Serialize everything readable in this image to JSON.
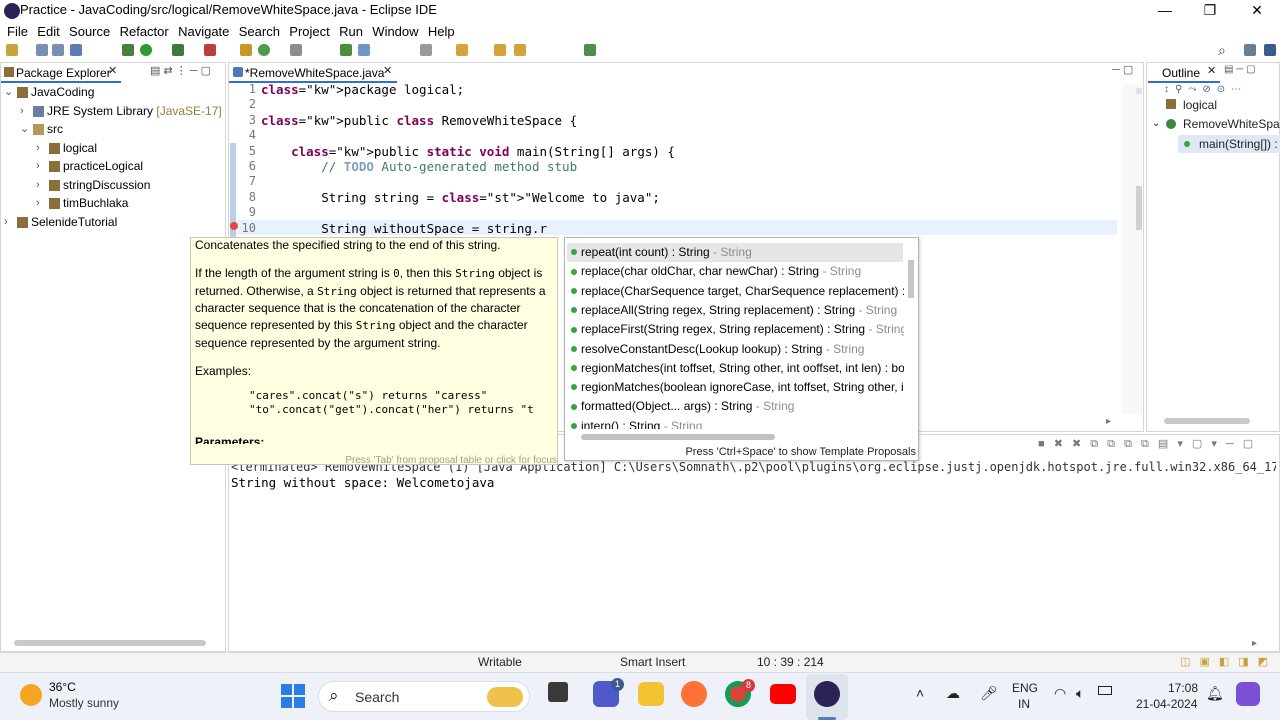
{
  "window": {
    "title": "Practice - JavaCoding/src/logical/RemoveWhiteSpace.java - Eclipse IDE",
    "minimize": "—",
    "maximize": "❐",
    "close": "✕"
  },
  "menu": [
    "File",
    "Edit",
    "Source",
    "Refactor",
    "Navigate",
    "Search",
    "Project",
    "Run",
    "Window",
    "Help"
  ],
  "package_explorer": {
    "title": "Package Explorer",
    "tree": [
      {
        "label": "JavaCoding",
        "twisty": "⌄",
        "depth": 0
      },
      {
        "label": "JRE System Library",
        "suffix": "[JavaSE-17]",
        "twisty": "›",
        "depth": 1
      },
      {
        "label": "src",
        "twisty": "⌄",
        "depth": 1
      },
      {
        "label": "logical",
        "twisty": "›",
        "depth": 2
      },
      {
        "label": "practiceLogical",
        "twisty": "›",
        "depth": 2
      },
      {
        "label": "stringDiscussion",
        "twisty": "›",
        "depth": 2
      },
      {
        "label": "timBuchlaka",
        "twisty": "›",
        "depth": 2
      },
      {
        "label": "SelenideTutorial",
        "twisty": "›",
        "depth": 0
      }
    ]
  },
  "editor": {
    "tab": "*RemoveWhiteSpace.java",
    "lines": [
      {
        "n": "1",
        "code": "package logical;"
      },
      {
        "n": "2",
        "code": ""
      },
      {
        "n": "3",
        "code": "public class RemoveWhiteSpace {"
      },
      {
        "n": "4",
        "code": ""
      },
      {
        "n": "5",
        "code": "    public static void main(String[] args) {"
      },
      {
        "n": "6",
        "code": "        // TODO Auto-generated method stub"
      },
      {
        "n": "7",
        "code": ""
      },
      {
        "n": "8",
        "code": "        String string = \"Welcome to java\";"
      },
      {
        "n": "9",
        "code": ""
      },
      {
        "n": "10",
        "code": "        String withoutSpace = string.r"
      }
    ]
  },
  "javadoc": {
    "summary": "Concatenates the specified string to the end of this string.",
    "para1": "If the length of the argument string is 0, then this String object is returned. Otherwise, a String object is returned that represents a character sequence that is the concatenation of the character sequence represented by this String object and the character sequence represented by the argument string.",
    "examples_label": "Examples:",
    "example1": "\"cares\".concat(\"s\") returns \"caress\"",
    "example2": "\"to\".concat(\"get\").concat(\"her\") returns \"t",
    "params_label": "Parameters:",
    "footer": "Press 'Tab' from proposal table or click for focus"
  },
  "proposals": {
    "items": [
      {
        "main": "repeat(int count) : String",
        "type": " - String"
      },
      {
        "main": "replace(char oldChar, char newChar) : String",
        "type": " - String"
      },
      {
        "main": "replace(CharSequence target, CharSequence replacement) : St",
        "type": ""
      },
      {
        "main": "replaceAll(String regex, String replacement) : String",
        "type": " - String"
      },
      {
        "main": "replaceFirst(String regex, String replacement) : String",
        "type": " - String"
      },
      {
        "main": "resolveConstantDesc(Lookup lookup) : String",
        "type": " - String"
      },
      {
        "main": "regionMatches(int toffset, String other, int ooffset, int len) : bo",
        "type": ""
      },
      {
        "main": "regionMatches(boolean ignoreCase, int toffset, String other, in",
        "type": ""
      },
      {
        "main": "formatted(Object... args) : String",
        "type": " - String"
      },
      {
        "main": "intern() : String",
        "type": " - String"
      }
    ],
    "footer": "Press 'Ctrl+Space' to show Template Proposals"
  },
  "outline": {
    "title": "Outline",
    "items": [
      "logical",
      "RemoveWhiteSpac",
      "main(String[]) : v"
    ]
  },
  "console": {
    "terminated": "<terminated> RemoveWhiteSpace (1) [Java Application] C:\\Users\\Somnath\\.p2\\pool\\plugins\\org.eclipse.justj.openjdk.hotspot.jre.full.win32.x86_64_17.0.4.v20220805-1047\\jre\\bin\\javaw.exe  (21-Apr-2",
    "output": "String without space: Welcometojava"
  },
  "status": {
    "mode": "Writable",
    "insert": "Smart Insert",
    "position": "10 : 39 : 214"
  },
  "taskbar": {
    "temp": "36°C",
    "weather": "Mostly sunny",
    "search": "Search",
    "lang1": "ENG",
    "lang2": "IN",
    "time": "17:08",
    "date": "21-04-2024",
    "badge_teams": "1",
    "badge_chrome": "8"
  },
  "colors": {
    "keyword": "#7f0055",
    "comment": "#3f7f5f",
    "string": "#2a00ff",
    "javadoc_bg": "#ffffe1",
    "selection": "#e8f2fe"
  }
}
